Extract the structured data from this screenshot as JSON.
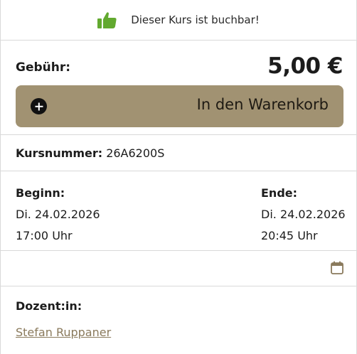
{
  "availability": {
    "text": "Dieser Kurs ist buchbar!",
    "icon": "thumbs-up-icon",
    "icon_color": "#62a92f"
  },
  "price": {
    "label": "Gebühr:",
    "value": "5,00 €"
  },
  "cart_button": {
    "label": "In den Warenkorb",
    "icon": "plus-circle-icon",
    "color": "#a19272"
  },
  "course_number": {
    "label": "Kursnummer:",
    "value": "26A6200S"
  },
  "schedule": {
    "begin": {
      "label": "Beginn:",
      "date": "Di. 24.02.2026",
      "time": "17:00 Uhr"
    },
    "end": {
      "label": "Ende:",
      "date": "Di. 24.02.2026",
      "time": "20:45 Uhr"
    }
  },
  "calendar": {
    "icon": "calendar-icon"
  },
  "teacher": {
    "label": "Dozent:in:",
    "name": "Stefan Ruppaner"
  }
}
